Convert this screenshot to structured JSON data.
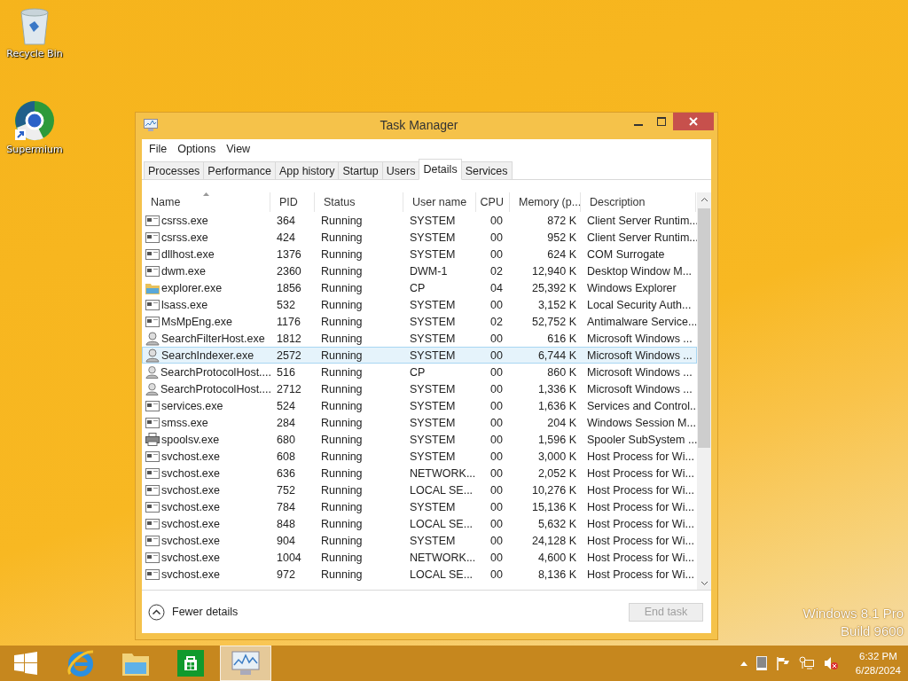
{
  "desktop_icons": [
    {
      "kind": "recycle",
      "label": "Recycle Bin"
    },
    {
      "kind": "browser",
      "label": "Supermium"
    }
  ],
  "window": {
    "title": "Task Manager"
  },
  "menu": [
    "File",
    "Options",
    "View"
  ],
  "tabs": [
    {
      "label": "Processes",
      "selected": false
    },
    {
      "label": "Performance",
      "selected": false
    },
    {
      "label": "App history",
      "selected": false
    },
    {
      "label": "Startup",
      "selected": false
    },
    {
      "label": "Users",
      "selected": false
    },
    {
      "label": "Details",
      "selected": true
    },
    {
      "label": "Services",
      "selected": false
    }
  ],
  "table": {
    "columns": [
      "Name",
      "PID",
      "Status",
      "User name",
      "CPU",
      "Memory (p...",
      "Description"
    ],
    "rows": [
      {
        "kind": "app",
        "selected": false,
        "cells": [
          "csrss.exe",
          "364",
          "Running",
          "SYSTEM",
          "00",
          "872 K",
          "Client Server Runtim..."
        ]
      },
      {
        "kind": "app",
        "selected": false,
        "cells": [
          "csrss.exe",
          "424",
          "Running",
          "SYSTEM",
          "00",
          "952 K",
          "Client Server Runtim..."
        ]
      },
      {
        "kind": "app",
        "selected": false,
        "cells": [
          "dllhost.exe",
          "1376",
          "Running",
          "SYSTEM",
          "00",
          "624 K",
          "COM Surrogate"
        ]
      },
      {
        "kind": "app",
        "selected": false,
        "cells": [
          "dwm.exe",
          "2360",
          "Running",
          "DWM-1",
          "02",
          "12,940 K",
          "Desktop Window M..."
        ]
      },
      {
        "kind": "folder",
        "selected": false,
        "cells": [
          "explorer.exe",
          "1856",
          "Running",
          "CP",
          "04",
          "25,392 K",
          "Windows Explorer"
        ]
      },
      {
        "kind": "app",
        "selected": false,
        "cells": [
          "lsass.exe",
          "532",
          "Running",
          "SYSTEM",
          "00",
          "3,152 K",
          "Local Security Auth..."
        ]
      },
      {
        "kind": "app",
        "selected": false,
        "cells": [
          "MsMpEng.exe",
          "1176",
          "Running",
          "SYSTEM",
          "02",
          "52,752 K",
          "Antimalware Service..."
        ]
      },
      {
        "kind": "search",
        "selected": false,
        "cells": [
          "SearchFilterHost.exe",
          "1812",
          "Running",
          "SYSTEM",
          "00",
          "616 K",
          "Microsoft Windows ..."
        ]
      },
      {
        "kind": "search",
        "selected": true,
        "cells": [
          "SearchIndexer.exe",
          "2572",
          "Running",
          "SYSTEM",
          "00",
          "6,744 K",
          "Microsoft Windows ..."
        ]
      },
      {
        "kind": "search",
        "selected": false,
        "cells": [
          "SearchProtocolHost....",
          "516",
          "Running",
          "CP",
          "00",
          "860 K",
          "Microsoft Windows ..."
        ]
      },
      {
        "kind": "search",
        "selected": false,
        "cells": [
          "SearchProtocolHost....",
          "2712",
          "Running",
          "SYSTEM",
          "00",
          "1,336 K",
          "Microsoft Windows ..."
        ]
      },
      {
        "kind": "app",
        "selected": false,
        "cells": [
          "services.exe",
          "524",
          "Running",
          "SYSTEM",
          "00",
          "1,636 K",
          "Services and Control..."
        ]
      },
      {
        "kind": "app",
        "selected": false,
        "cells": [
          "smss.exe",
          "284",
          "Running",
          "SYSTEM",
          "00",
          "204 K",
          "Windows Session M..."
        ]
      },
      {
        "kind": "printer",
        "selected": false,
        "cells": [
          "spoolsv.exe",
          "680",
          "Running",
          "SYSTEM",
          "00",
          "1,596 K",
          "Spooler SubSystem ..."
        ]
      },
      {
        "kind": "app",
        "selected": false,
        "cells": [
          "svchost.exe",
          "608",
          "Running",
          "SYSTEM",
          "00",
          "3,000 K",
          "Host Process for Wi..."
        ]
      },
      {
        "kind": "app",
        "selected": false,
        "cells": [
          "svchost.exe",
          "636",
          "Running",
          "NETWORK...",
          "00",
          "2,052 K",
          "Host Process for Wi..."
        ]
      },
      {
        "kind": "app",
        "selected": false,
        "cells": [
          "svchost.exe",
          "752",
          "Running",
          "LOCAL SE...",
          "00",
          "10,276 K",
          "Host Process for Wi..."
        ]
      },
      {
        "kind": "app",
        "selected": false,
        "cells": [
          "svchost.exe",
          "784",
          "Running",
          "SYSTEM",
          "00",
          "15,136 K",
          "Host Process for Wi..."
        ]
      },
      {
        "kind": "app",
        "selected": false,
        "cells": [
          "svchost.exe",
          "848",
          "Running",
          "LOCAL SE...",
          "00",
          "5,632 K",
          "Host Process for Wi..."
        ]
      },
      {
        "kind": "app",
        "selected": false,
        "cells": [
          "svchost.exe",
          "904",
          "Running",
          "SYSTEM",
          "00",
          "24,128 K",
          "Host Process for Wi..."
        ]
      },
      {
        "kind": "app",
        "selected": false,
        "cells": [
          "svchost.exe",
          "1004",
          "Running",
          "NETWORK...",
          "00",
          "4,600 K",
          "Host Process for Wi..."
        ]
      },
      {
        "kind": "app",
        "selected": false,
        "cells": [
          "svchost.exe",
          "972",
          "Running",
          "LOCAL SE...",
          "00",
          "8,136 K",
          "Host Process for Wi..."
        ]
      }
    ]
  },
  "footer": {
    "fewer_details": "Fewer details",
    "end_task": {
      "label": "End task",
      "disabled": true
    }
  },
  "watermark": [
    "Windows 8.1 Pro",
    "Build 9600"
  ],
  "taskbar": {
    "apps": [
      {
        "kind": "start",
        "active": false
      },
      {
        "kind": "ie",
        "active": false
      },
      {
        "kind": "files",
        "active": false
      },
      {
        "kind": "store",
        "active": false
      },
      {
        "kind": "taskmgr",
        "active": true
      }
    ],
    "time": "6:32 PM",
    "date": "6/28/2024"
  }
}
